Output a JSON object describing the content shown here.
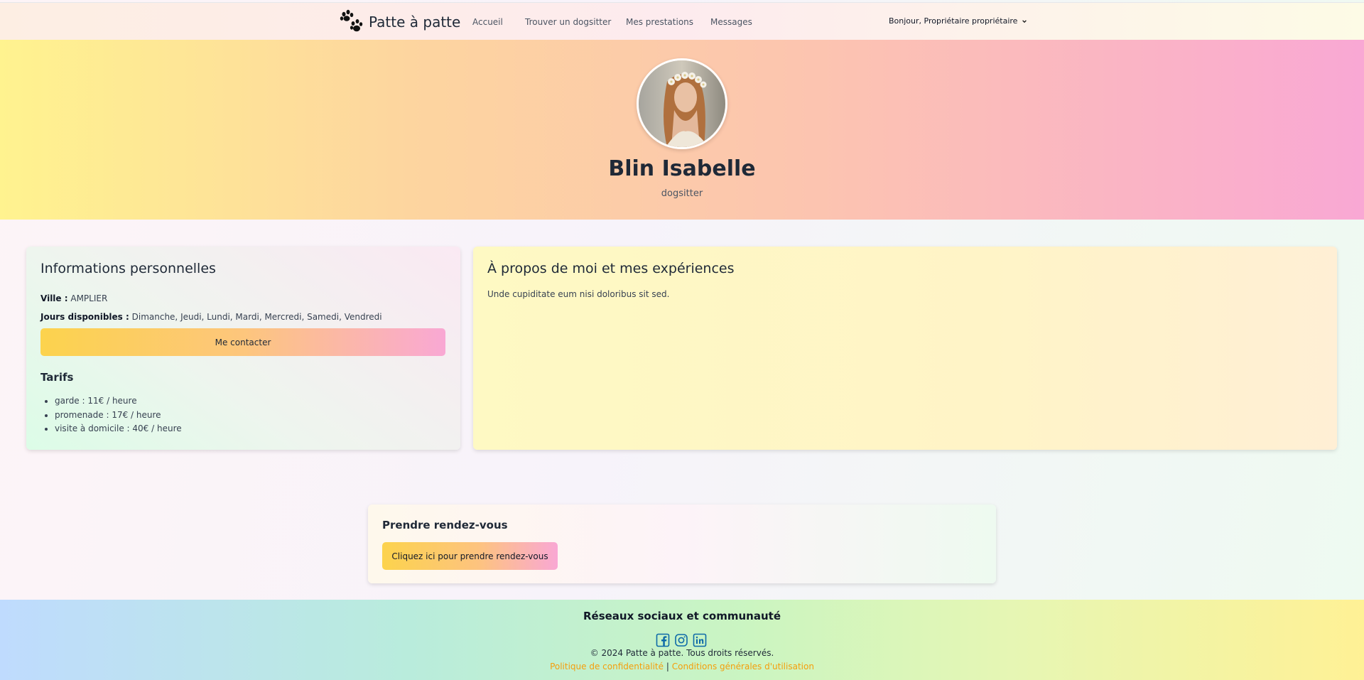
{
  "nav": {
    "brand": "Patte à patte",
    "links": [
      "Accueil",
      "Trouver un dogsitter",
      "Mes prestations",
      "Messages"
    ],
    "user_greeting": "Bonjour, Propriétaire propriétaire"
  },
  "profile": {
    "name": "Blin Isabelle",
    "role": "dogsitter"
  },
  "info": {
    "title": "Informations personnelles",
    "city_label": "Ville :",
    "city": "AMPLIER",
    "days_label": "Jours disponibles :",
    "days": "Dimanche, Jeudi, Lundi, Mardi, Mercredi, Samedi, Vendredi",
    "contact_button": "Me contacter",
    "tarifs_title": "Tarifs",
    "tarifs": [
      "garde : 11€ / heure",
      "promenade : 17€ / heure",
      "visite à domicile : 40€ / heure"
    ]
  },
  "about": {
    "title": "À propos de moi et mes expériences",
    "text": "Unde cupiditate eum nisi doloribus sit sed."
  },
  "appointment": {
    "title": "Prendre rendez-vous",
    "button": "Cliquez ici pour prendre rendez-vous"
  },
  "footer": {
    "title": "Réseaux sociaux et communauté",
    "socials": [
      "facebook-icon",
      "instagram-icon",
      "linkedin-icon"
    ],
    "copyright": "© 2024 Patte à patte. Tous droits réservés.",
    "privacy": "Politique de confidentialité",
    "separator": "|",
    "terms": "Conditions générales d'utilisation"
  },
  "colors": {
    "accent": "#f59e0b",
    "social": "#0e6aa8"
  }
}
